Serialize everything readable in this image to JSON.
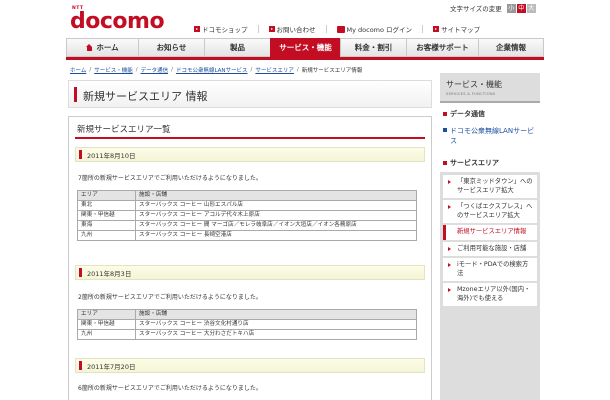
{
  "header": {
    "logo_ntt": "NTT",
    "logo_text": "docomo",
    "font_size_label": "文字サイズの変更",
    "font_size_buttons": [
      "小",
      "中",
      "大"
    ],
    "links": [
      "ドコモショップ",
      "お問い合わせ",
      "My docomo ログイン",
      "サイトマップ"
    ]
  },
  "nav": {
    "tabs": [
      "ホーム",
      "お知らせ",
      "製品",
      "サービス・機能",
      "料金・割引",
      "お客様サポート",
      "企業情報"
    ],
    "active_index": 3
  },
  "breadcrumb": {
    "items": [
      "ホーム",
      "サービス・機能",
      "データ通信",
      "ドコモ公衆無線LANサービス",
      "サービスエリア"
    ],
    "current": "新規サービスエリア情報"
  },
  "main": {
    "page_title": "新規サービスエリア 情報",
    "section_title": "新規サービスエリア一覧",
    "table_headers": [
      "エリア",
      "施設・店舗"
    ],
    "entries": [
      {
        "date": "2011年8月10日",
        "intro": "7箇所の新規サービスエリアでご利用いただけるようになりました。",
        "rows": [
          [
            "東北",
            "スターバックス コーヒー 山形エスパル店"
          ],
          [
            "関東・甲信越",
            "スターバックス コーヒー アコルデ代々木上原店"
          ],
          [
            "東海",
            "スターバックス コーヒー 間 マーゴ店／モレラ岐阜店／イオン大垣店／イオン各務原店"
          ],
          [
            "九州",
            "スターバックス コーヒー 長崎空港店"
          ]
        ]
      },
      {
        "date": "2011年8月3日",
        "intro": "2箇所の新規サービスエリアでご利用いただけるようになりました。",
        "rows": [
          [
            "関東・甲信越",
            "スターバックス コーヒー 渋谷文化村通り店"
          ],
          [
            "九州",
            "スターバックス コーヒー 大分わさだトキハ店"
          ]
        ]
      },
      {
        "date": "2011年7月20日",
        "intro": "6箇所の新規サービスエリアでご利用いただけるようになりました。",
        "rows": []
      }
    ]
  },
  "sidebar": {
    "title": "サービス・機能",
    "subtitle": "SERVICES & FUNCTIONS",
    "section_data": "データ通信",
    "section_link": "ドコモ公衆無線LANサービス",
    "section_area": "サービスエリア",
    "items": [
      {
        "label": "「東京ミッドタウン」へのサービスエリア拡大",
        "active": false
      },
      {
        "label": "「つくばエクスプレス」へのサービスエリア拡大",
        "active": false
      },
      {
        "label": "新規サービスエリア情報",
        "active": true
      },
      {
        "label": "ご利用可能な施設・店舗",
        "active": false
      },
      {
        "label": "iモード・PDAでの検索方法",
        "active": false
      },
      {
        "label": "Mzoneエリア以外(国内・海外)でも使える",
        "active": false
      }
    ]
  },
  "colors": {
    "brand": "#c30d23",
    "link": "#1a4e9e"
  }
}
